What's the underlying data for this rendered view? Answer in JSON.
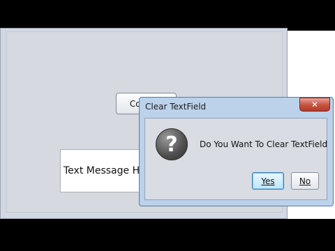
{
  "main_window": {
    "confirm_label": "Confirm",
    "text_field_value": "Text Message Here"
  },
  "dialog": {
    "title": "Clear TextField",
    "close_glyph": "✕",
    "icon": "question-icon",
    "icon_glyph": "?",
    "message": "Do You Want To Clear TextField",
    "yes_label": "Yes",
    "no_label": "No"
  }
}
